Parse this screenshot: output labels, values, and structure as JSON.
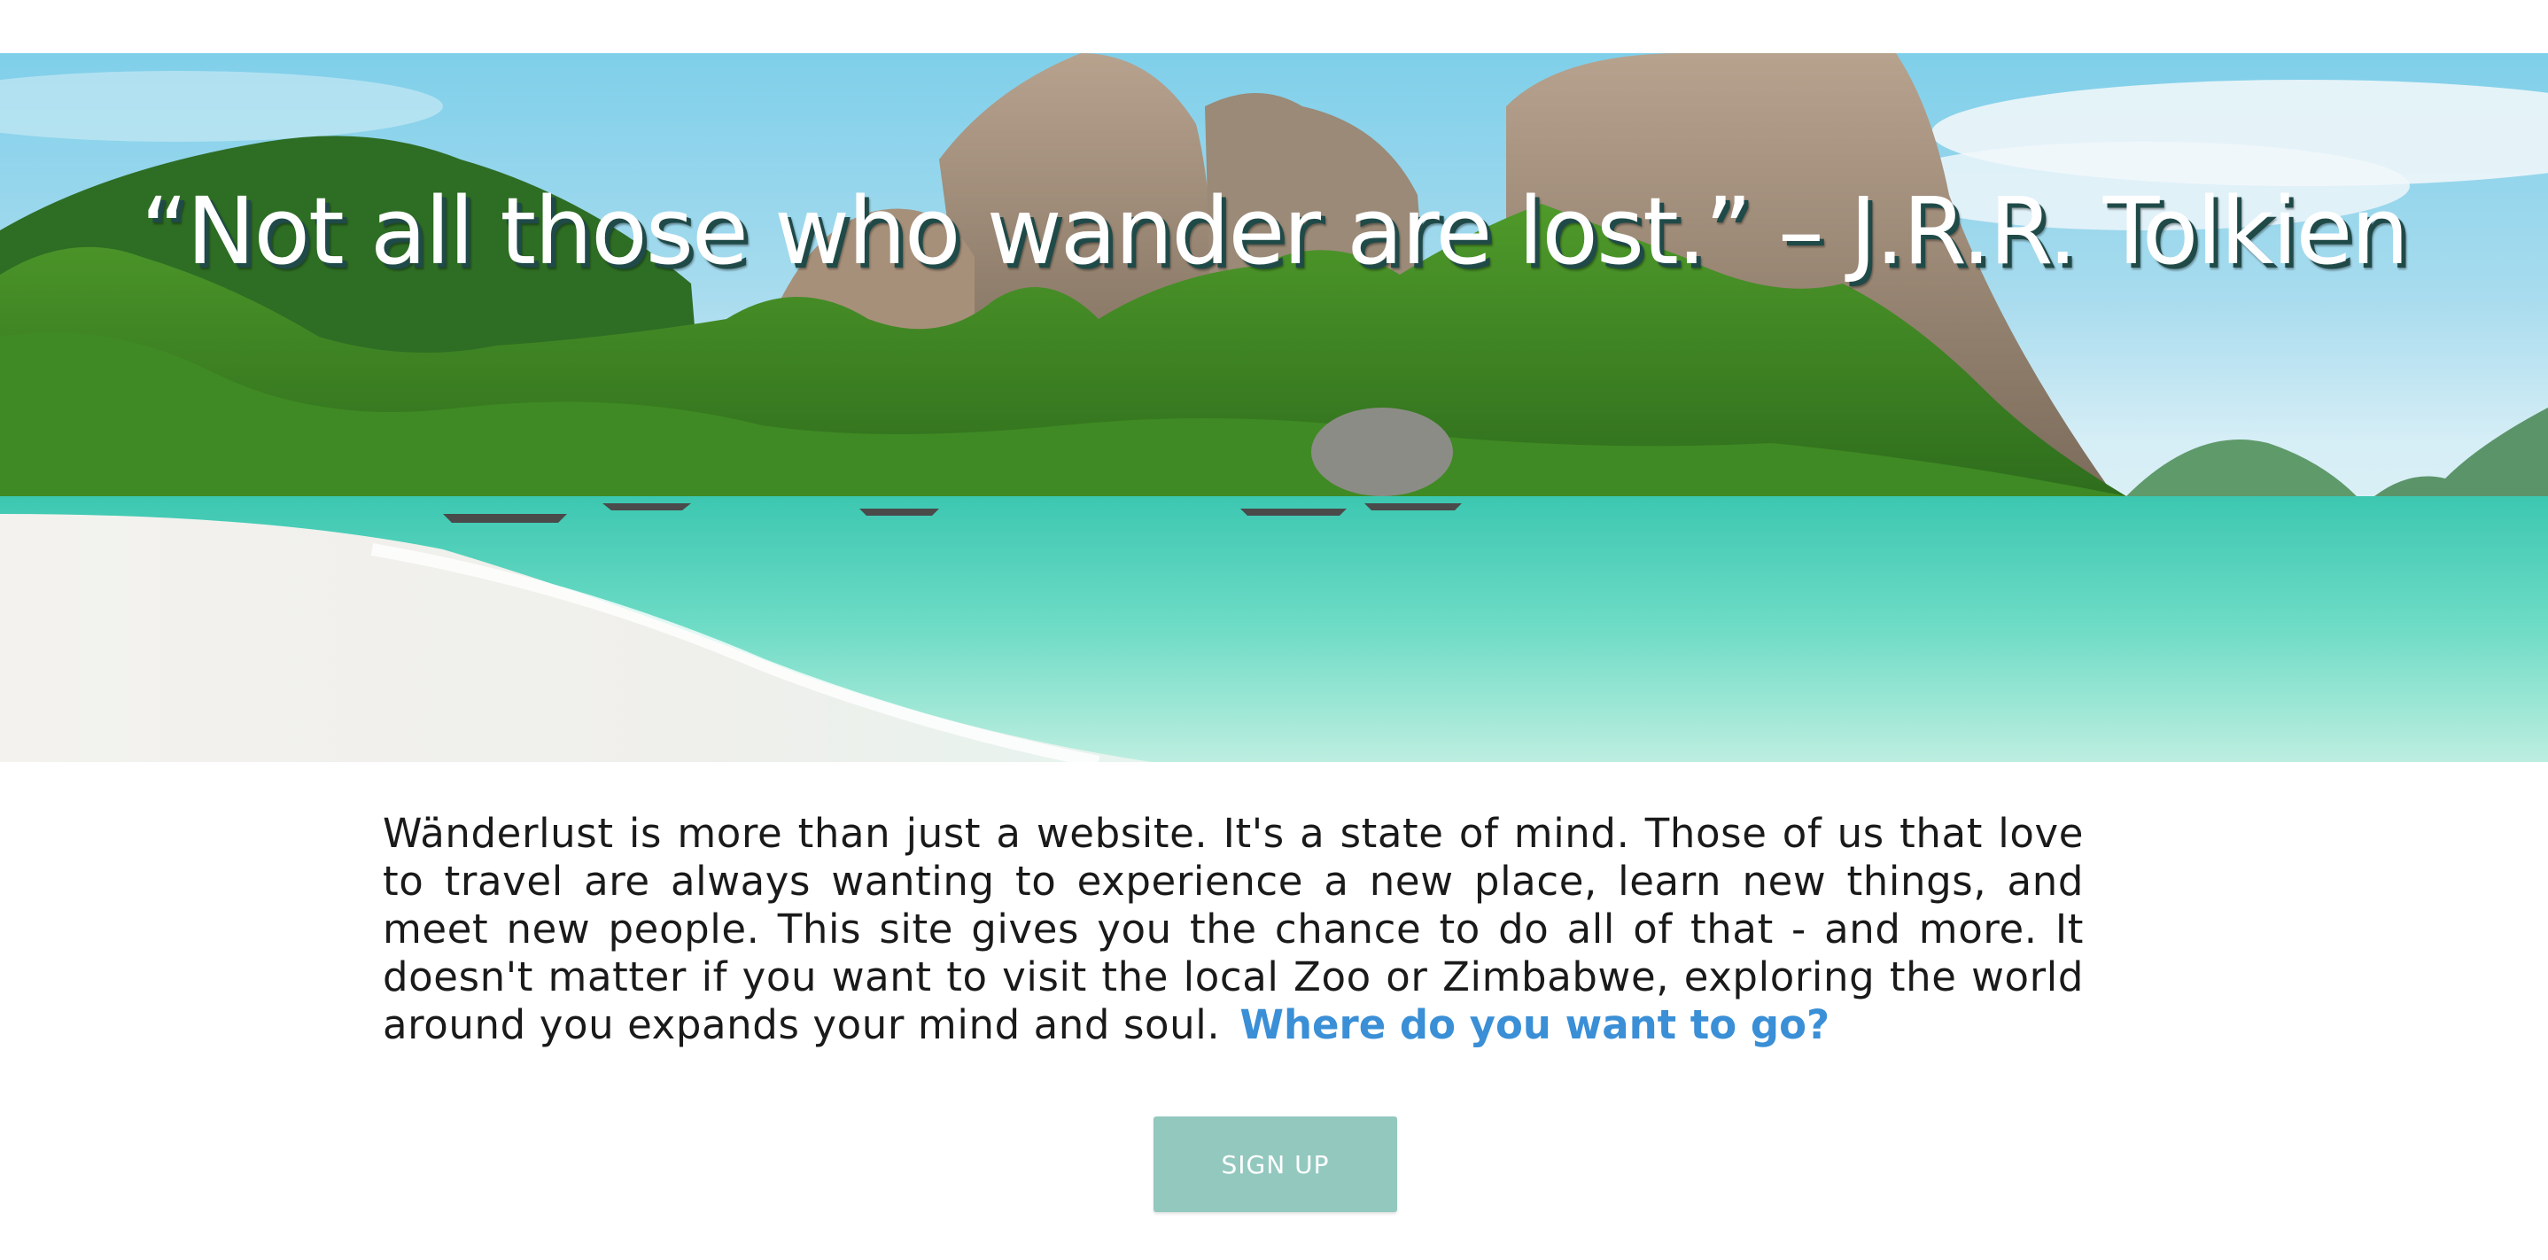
{
  "hero": {
    "quote": "“Not all those who wander are lost.” – J.R.R. Tolkien"
  },
  "intro": {
    "text": "Wänderlust is more than just a website. It's a state of mind. Those of us that love to travel are always wanting to experience a new place, learn new things, and meet new people. This site gives you the chance to do all of that - and more. It doesn't matter if you want to visit the local Zoo or Zimbabwe, exploring the world around you expands your mind and soul.",
    "cta_link": "Where do you want to go?"
  },
  "signup": {
    "label": "SIGN UP"
  },
  "colors": {
    "link": "#3a8fd6",
    "button": "#93c8bf",
    "quote_shadow": "#1f4a48"
  }
}
